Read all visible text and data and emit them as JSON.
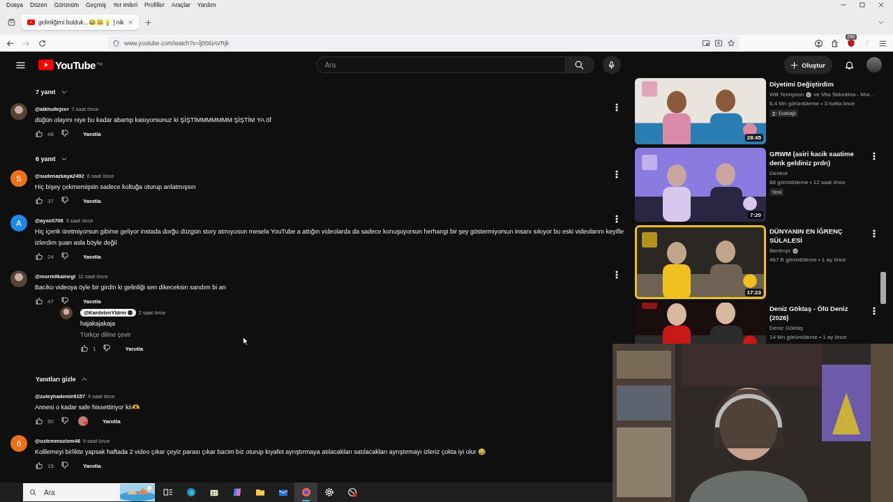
{
  "browser": {
    "menu": [
      "Dosya",
      "Düzen",
      "Görünüm",
      "Geçmiş",
      "Yer imleri",
      "Profiller",
      "Araçlar",
      "Yardım"
    ],
    "tabs": [
      {
        "title": "gelinliğimi bulduk...😂🤐💡 | nik",
        "selected": true
      }
    ],
    "url": "www.youtube.com/watch?v=lj006iAVRjk",
    "extension_badge": "260"
  },
  "youtube": {
    "logo_text": "YouTube",
    "logo_region": "TR",
    "search": {
      "placeholder": "Ara"
    },
    "create_label": "Oluştur"
  },
  "comments": [
    {
      "kind": "toggle",
      "label": "7 yanıt",
      "expanded": false
    },
    {
      "kind": "comment",
      "author": "@alkhullejxer",
      "time": "7 saat önce",
      "text": "düğün olayını niye bu kadar abartıp kasıyorsunuz ki ŞİŞTİMMMMMMM ŞİŞTİM YA öf",
      "likes": "46",
      "reply_label": "Yanıtla"
    },
    {
      "kind": "toggle",
      "label": "6 yanıt",
      "expanded": false
    },
    {
      "kind": "comment",
      "author": "@sudenazkaya2492",
      "time": "6 saat önce",
      "text": "Hiç bişey çekmemişsin sadece koltuğa oturup anlatmışsın",
      "likes": "37",
      "reply_label": "Yanıtla",
      "avatar": {
        "kind": "letter",
        "letter": "S",
        "color": "#e8711c"
      }
    },
    {
      "kind": "comment",
      "author": "@ayse0706",
      "time": "5 saat önce",
      "text": "Hiç içerik üretmiyorsun gibime geliyor instada dorğu düzgün story atmıyosun mesela YouTube a attığın videolarda da sadece konuşuyorsun herhangi bir şey göstermiyorsun insanı sıkıyor bu eski videolarını keyifle izlerdim şuan asla böyle değil",
      "likes": "24",
      "reply_label": "Yanıtla",
      "avatar": {
        "kind": "letter",
        "letter": "A",
        "color": "#1e88e5"
      }
    },
    {
      "kind": "comment",
      "author": "@mormilkainegi",
      "time": "11 saat önce",
      "text": "Baciko videoya öyle bir girdin ki gelinliği sen dikeceksin sandım bi an",
      "likes": "47",
      "reply_label": "Yanıtla",
      "children": [
        {
          "kind": "comment",
          "author": "@KardelenYldrm",
          "creator": true,
          "time": "2 saat önce",
          "text": "hajakajakaja",
          "translate": "Türkçe diline çevir",
          "likes": "1",
          "reply_label": "Yanıtla"
        }
      ]
    },
    {
      "kind": "toggle",
      "label": "Yanıtları gizle",
      "expanded": true
    },
    {
      "kind": "comment",
      "author": "@zuleyhademir6157",
      "time": "9 saat önce",
      "text": "Annesi o kadar safe hissettiriyor kii🫶",
      "likes": "50",
      "hearted": true,
      "reply_label": "Yanıtla"
    },
    {
      "kind": "comment",
      "author": "@ozlemmozlem46",
      "time": "9 saat önce",
      "text": "Kolilemeyi birlikte yapsak haftada 2 video çıkar çeyiz parası çıkar bacim biz oturup kıyafet ayrıştırmaya atılacakları satılacakları ayrıştırmayı izleriz çokta iyi olur 😂",
      "likes": "15",
      "reply_label": "Yanıtla",
      "avatar": {
        "kind": "letter",
        "letter": "ö",
        "color": "#e8711c"
      }
    }
  ],
  "recommendations": [
    {
      "title": "Diyetimi Değiştirdim",
      "channel": "Will Tennyson",
      "verified": true,
      "channel_extra": "ve Vita Sidorkina - Mor...",
      "meta": "6,4 Mn görüntüleme • 3 hafta önce",
      "badge": {
        "kind": "dubbed",
        "label": "Dublajlı"
      },
      "duration": "28:45"
    },
    {
      "title": "GRWM (asiri kacik saatime denk geldiniz prdn)",
      "channel": "Denkot",
      "verified": false,
      "meta": "88 görüntüleme • 12 saat önce",
      "badge": {
        "kind": "plain",
        "label": "Yeni"
      },
      "duration": "7:20"
    },
    {
      "title": "DÜNYANIN EN İĞRENÇ SÜLALESİ",
      "channel": "Bentropi",
      "verified": true,
      "meta": "467 B görüntüleme • 1 ay önce",
      "duration": "17:23"
    },
    {
      "title": "Deniz Göktaş - Ölü Deniz (2026)",
      "channel": "Deniz Göktaş",
      "verified": false,
      "meta": "14 Mn görüntüleme • 1 ay önce"
    }
  ],
  "taskbar": {
    "search": {
      "placeholder": "Ara"
    },
    "apps": [
      {
        "selected": false
      },
      {
        "selected": false
      },
      {
        "selected": false
      },
      {
        "selected": false
      },
      {
        "selected": false
      },
      {
        "selected": false
      },
      {
        "selected": true
      },
      {
        "selected": false
      },
      {
        "selected": false
      }
    ]
  }
}
